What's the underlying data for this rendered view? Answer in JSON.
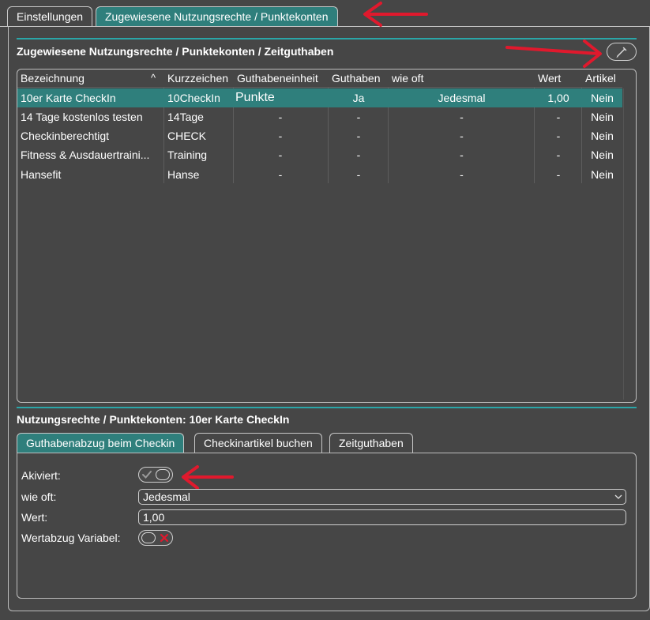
{
  "top_tabs": [
    {
      "label": "Einstellungen"
    },
    {
      "label": "Zugewiesene Nutzungsrechte / Punktekonten"
    }
  ],
  "section": {
    "title": "Zugewiesene Nutzungsrechte / Punktekonten / Zeitguthaben"
  },
  "table": {
    "columns": [
      "Bezeichnung",
      "Kurzzeichen",
      "Guthabeneinheit",
      "Guthaben",
      "wie oft",
      "Wert",
      "Artikel"
    ],
    "sort_indicator": "^",
    "rows": [
      [
        "10er Karte CheckIn",
        "10CheckIn",
        "Punkte",
        "Ja",
        "Jedesmal",
        "1,00",
        "Nein"
      ],
      [
        "14 Tage kostenlos testen",
        "14Tage",
        "-",
        "-",
        "-",
        "-",
        "Nein"
      ],
      [
        "Checkinberechtigt",
        "CHECK",
        "-",
        "-",
        "-",
        "-",
        "Nein"
      ],
      [
        "Fitness & Ausdauertraini...",
        "Training",
        "-",
        "-",
        "-",
        "-",
        "Nein"
      ],
      [
        "Hansefit",
        "Hanse",
        "-",
        "-",
        "-",
        "-",
        "Nein"
      ]
    ]
  },
  "detail": {
    "title": "Nutzungsrechte / Punktekonten: 10er Karte CheckIn",
    "tabs": [
      {
        "label": "Guthabenabzug beim Checkin"
      },
      {
        "label": "Checkinartikel buchen"
      },
      {
        "label": "Zeitguthaben"
      }
    ],
    "fields": {
      "aktiviert_label": "Akiviert:",
      "wie_oft_label": "wie oft:",
      "wie_oft_value": "Jedesmal",
      "wert_label": "Wert:",
      "wert_value": "1,00",
      "variabel_label": "Wertabzug Variabel:"
    }
  },
  "colors": {
    "accent": "#2f7f7c",
    "teal_line": "#2aa6a8",
    "background": "#464646",
    "annotation_arrow": "#e0192d"
  },
  "icons": {
    "edit": "pencil-icon",
    "sort": "sort-ascending-icon",
    "dropdown": "chevron-down-icon",
    "check": "check-icon",
    "cross": "cross-icon",
    "annotation": "red-arrow-icon"
  }
}
